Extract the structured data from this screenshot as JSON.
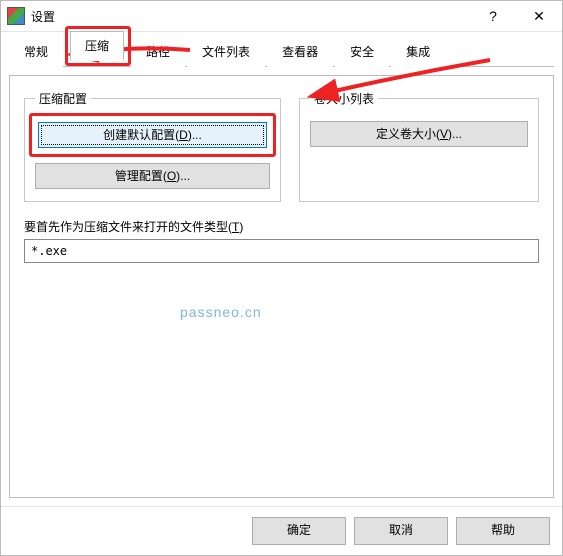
{
  "window": {
    "title": "设置"
  },
  "titlebar_controls": {
    "help": "?",
    "close": "✕"
  },
  "tabs": {
    "items": [
      {
        "label": "常规"
      },
      {
        "label": "压缩"
      },
      {
        "label": "路径"
      },
      {
        "label": "文件列表"
      },
      {
        "label": "查看器"
      },
      {
        "label": "安全"
      },
      {
        "label": "集成"
      }
    ],
    "active_index": 1
  },
  "groups": {
    "compress_profile": {
      "legend": "压缩配置",
      "create_default": "创建默认配置(",
      "create_default_hotkey": "D",
      "create_default_suffix": ")...",
      "manage": "管理配置(",
      "manage_hotkey": "O",
      "manage_suffix": ")..."
    },
    "volume_list": {
      "legend": "卷大小列表",
      "define": "定义卷大小(",
      "define_hotkey": "V",
      "define_suffix": ")..."
    }
  },
  "filetype": {
    "label_prefix": "要首先作为压缩文件来打开的文件类型(",
    "label_hotkey": "T",
    "label_suffix": ")",
    "value": "*.exe"
  },
  "footer": {
    "ok": "确定",
    "cancel": "取消",
    "help": "帮助"
  },
  "watermark": "passneo.cn"
}
